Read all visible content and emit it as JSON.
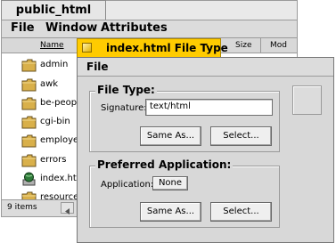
{
  "tracker": {
    "title": "public_html",
    "menu": [
      "File",
      "Window",
      "Attributes"
    ],
    "columns": {
      "name": "Name",
      "size": "Size",
      "modified": "Mod"
    },
    "files": [
      {
        "name": "admin",
        "icon": "folder-icon"
      },
      {
        "name": "awk",
        "icon": "folder-icon"
      },
      {
        "name": "be-peop",
        "icon": "folder-icon"
      },
      {
        "name": "cgi-bin",
        "icon": "folder-icon"
      },
      {
        "name": "employe",
        "icon": "folder-icon"
      },
      {
        "name": "errors",
        "icon": "folder-icon"
      },
      {
        "name": "index.ht",
        "icon": "html-file-icon"
      },
      {
        "name": "resource",
        "icon": "folder-icon"
      }
    ],
    "status": "9 items"
  },
  "file_type_window": {
    "title": "index.html File Type",
    "menu_file": "File",
    "file_type_group": "File Type:",
    "signature_label": "Signature:",
    "signature_value": "text/html",
    "same_as_label": "Same As...",
    "select_label": "Select...",
    "preferred_group": "Preferred Application:",
    "application_label": "Application:",
    "application_value": "None",
    "same_as_label_2": "Same As...",
    "select_label_2": "Select..."
  },
  "colors": {
    "active_tab": "#ffcb00",
    "window_bg": "#d8d8d8",
    "folder": "#d9b04a"
  }
}
